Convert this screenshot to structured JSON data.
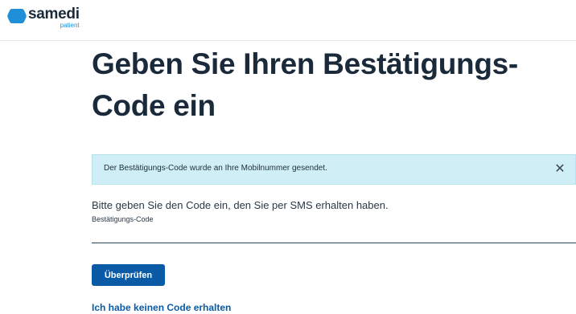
{
  "brand": {
    "name": "samedi",
    "subtitle": "patient",
    "accent_color": "#1f8fd8",
    "icon": "samedi-logo-icon"
  },
  "page": {
    "title": "Geben Sie Ihren Bestätigungs-Code ein"
  },
  "alert": {
    "message": "Der Bestätigungs-Code wurde an Ihre Mobilnummer gesendet.",
    "close_icon": "close-icon",
    "close_glyph": "✕",
    "background_color": "#cfeef6"
  },
  "form": {
    "instruction": "Bitte geben Sie den Code ein, den Sie per SMS erhalten haben.",
    "code_label": "Bestätigungs-Code",
    "code_value": "",
    "submit_label": "Überprüfen",
    "submit_color": "#0a5aa6",
    "no_code_link": "Ich habe keinen Code erhalten"
  }
}
